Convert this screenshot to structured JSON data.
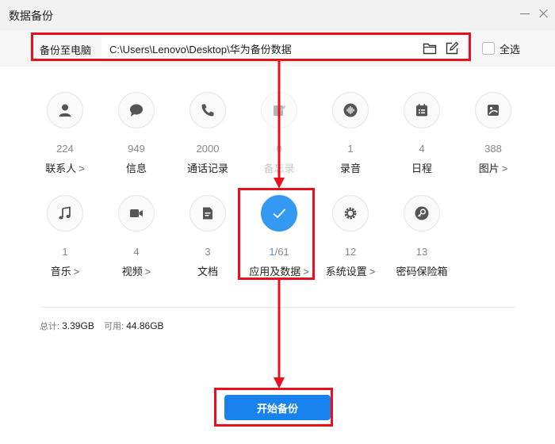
{
  "window": {
    "title": "数据备份"
  },
  "pathbar": {
    "label": "备份至电脑",
    "path": "C:\\Users\\Lenovo\\Desktop\\华为备份数据",
    "select_all_label": "全选"
  },
  "categories": [
    {
      "count": "224",
      "label": "联系人",
      "icon": "person-icon"
    },
    {
      "count": "949",
      "label": "信息",
      "icon": "message-icon"
    },
    {
      "count": "2000",
      "label": "通话记录",
      "icon": "phone-icon"
    },
    {
      "count": "0",
      "label": "备忘录",
      "icon": "memo-icon"
    },
    {
      "count": "1",
      "label": "录音",
      "icon": "recording-icon"
    },
    {
      "count": "4",
      "label": "日程",
      "icon": "calendar-icon"
    },
    {
      "count": "388",
      "label": "图片",
      "icon": "image-icon"
    },
    {
      "count": "1",
      "label": "音乐",
      "icon": "music-icon"
    },
    {
      "count": "4",
      "label": "视频",
      "icon": "video-icon"
    },
    {
      "count": "3",
      "label": "文档",
      "icon": "document-icon"
    },
    {
      "count_selected": "1",
      "count_total": "/61",
      "label": "应用及数据",
      "icon": "check-icon"
    },
    {
      "count": "12",
      "label": "系统设置",
      "icon": "gear-icon"
    },
    {
      "count": "13",
      "label": "密码保险箱",
      "icon": "key-icon"
    }
  ],
  "chevron": ">",
  "storage": {
    "total_label": "总计:",
    "total_value": "3.39GB",
    "available_label": "可用:",
    "available_value": "44.86GB"
  },
  "start_button": {
    "label": "开始备份"
  },
  "colors": {
    "accent": "#1a82ee",
    "selected": "#3399f3",
    "annotation": "#e8101d"
  }
}
